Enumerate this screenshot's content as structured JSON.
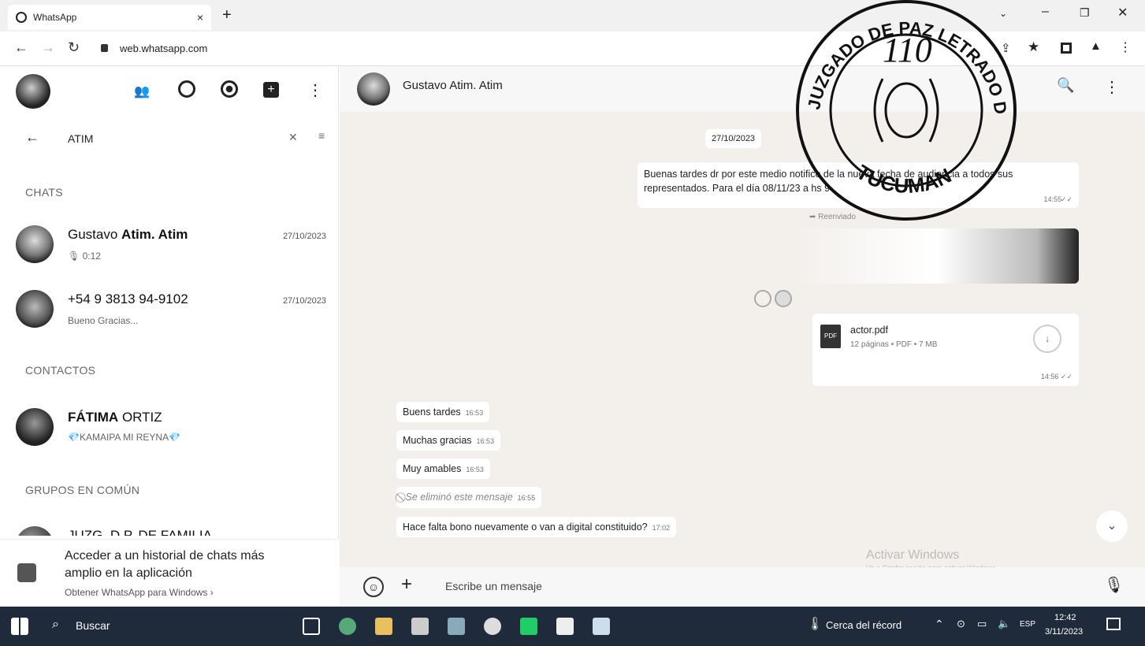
{
  "browser": {
    "tab_title": "WhatsApp",
    "url": "web.whatsapp.com"
  },
  "sidebar": {
    "search_value": "ATIM",
    "chats_header": "CHATS",
    "chats": [
      {
        "name_a": "Gustavo ",
        "name_b": "Atim. Atim",
        "sub": "0:12",
        "date": "27/10/2023"
      },
      {
        "name_a": "+54 9 3813 94-9102",
        "name_b": "",
        "sub": "Bueno Gracias...",
        "date": "27/10/2023"
      }
    ],
    "contacts_header": "CONTACTOS",
    "contact": {
      "name_a": "FÁTIMA",
      "name_b": " ORTIZ",
      "sub": "💎KAMAIPA MI REYNA💎"
    },
    "groups_header": "GRUPOS EN COMÚN",
    "group_partial": "JUZG. D.P. DE FAMILIA",
    "promo": {
      "line1": "Acceder a un historial de chats más",
      "line2": "amplio en la aplicación",
      "link": "Obtener WhatsApp para Windows"
    }
  },
  "chat": {
    "contact_name": "Gustavo Atim. Atim",
    "date_chip": "27/10/2023",
    "out_message_1": "Buenas tardes dr por este medio notifico de la nueva fecha de audiencia a todos sus representados. Para el día 08/11/23 a hs 9",
    "out_time_1": "14:55",
    "forwarded_label": "Reenviado",
    "file_name": "actor.pdf",
    "file_meta": "12 páginas • PDF • 7 MB",
    "file_badge": "PDF",
    "out_time_2": "14:56",
    "incoming": [
      {
        "text": "Buens tardes",
        "time": "16:53"
      },
      {
        "text": "Muchas gracias",
        "time": "16:53"
      },
      {
        "text": "Muy amables",
        "time": "16:53"
      },
      {
        "text": "Se eliminó este mensaje",
        "time": "16:55"
      },
      {
        "text": "Hace falta bono nuevamente o van a digital constituido?",
        "time": "17:02"
      }
    ],
    "composer_placeholder": "Escribe un mensaje",
    "watermark_line1": "Activar Windows",
    "watermark_line2": "Ve a Configuración para activar Windows."
  },
  "stamp": {
    "top_text": "JUZGADO DE PAZ LETRADO DE FAMILIA",
    "bottom_text": "TUCUMAN",
    "number": "110"
  },
  "taskbar": {
    "search_label": "Buscar",
    "weather": "Cerca del récord",
    "language": "ESP",
    "time": "12:42",
    "date": "3/11/2023"
  },
  "colors": {
    "chat_bg": "#f3f0ec",
    "bubble": "#ffffff",
    "taskbar": "#1f2a3a"
  }
}
